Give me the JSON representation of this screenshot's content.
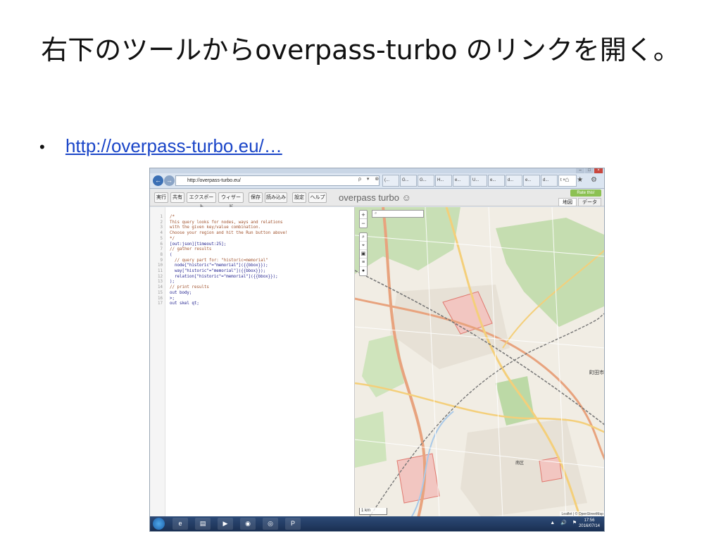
{
  "slide": {
    "title": "右下のツールからoverpass-turbo のリンクを開く。",
    "bullet_link": "http://overpass-turbo.eu/…"
  },
  "browser": {
    "url": "http://overpass-turbo.eu/",
    "url_icons": "ρ ▾ ⊗ C",
    "tabs": [
      {
        "label": "(... ",
        "active": false
      },
      {
        "label": "G...",
        "active": false
      },
      {
        "label": "G...",
        "active": false
      },
      {
        "label": "H...",
        "active": false
      },
      {
        "label": "e...",
        "active": false
      },
      {
        "label": "U...",
        "active": false
      },
      {
        "label": "e...",
        "active": false
      },
      {
        "label": "d...",
        "active": false
      },
      {
        "label": "e...",
        "active": false
      },
      {
        "label": "d...",
        "active": false
      },
      {
        "label": "t ×",
        "active": true
      }
    ],
    "icons": [
      "home-icon",
      "star-icon",
      "gear-icon"
    ],
    "icon_glyphs": "⌂ ★ ⚙"
  },
  "toolbar": {
    "buttons": [
      "実行",
      "共有",
      "エクスポート",
      "ウィザード",
      "保存",
      "読み込み",
      "設定",
      "ヘルプ"
    ],
    "app_title": "overpass turbo ☺",
    "rate_label": "Rate this!",
    "view_tabs": [
      "地図",
      "データ"
    ]
  },
  "editor": {
    "lines": [
      {
        "n": "1",
        "text": "/*",
        "kind": "comment"
      },
      {
        "n": "2",
        "text": "This query looks for nodes, ways and relations",
        "kind": "comment"
      },
      {
        "n": "3",
        "text": "with the given key/value combination.",
        "kind": "comment"
      },
      {
        "n": "4",
        "text": "Choose your region and hit the Run button above!",
        "kind": "comment"
      },
      {
        "n": "5",
        "text": "*/",
        "kind": "comment"
      },
      {
        "n": "6",
        "text": "[out:json][timeout:25];",
        "kind": "code"
      },
      {
        "n": "7",
        "text": "// gather results",
        "kind": "comment"
      },
      {
        "n": "8",
        "text": "(",
        "kind": "code"
      },
      {
        "n": "9",
        "text": "  // query part for: \"historic=memorial\"",
        "kind": "comment"
      },
      {
        "n": "10",
        "text": "  node[\"historic\"=\"memorial\"]({{bbox}});",
        "kind": "code"
      },
      {
        "n": "11",
        "text": "  way[\"historic\"=\"memorial\"]({{bbox}});",
        "kind": "code"
      },
      {
        "n": "12",
        "text": "  relation[\"historic\"=\"memorial\"]({{bbox}});",
        "kind": "code"
      },
      {
        "n": "13",
        "text": ");",
        "kind": "code"
      },
      {
        "n": "14",
        "text": "// print results",
        "kind": "comment"
      },
      {
        "n": "15",
        "text": "out body;",
        "kind": "code"
      },
      {
        "n": "16",
        "text": ">;",
        "kind": "code"
      },
      {
        "n": "17",
        "text": "out skel qt;",
        "kind": "code"
      }
    ]
  },
  "map": {
    "zoom_in": "+",
    "zoom_out": "−",
    "tools": [
      "⌕",
      "⌖",
      "▣",
      "≡",
      "●"
    ],
    "scale_label": "1 km",
    "attribution": "Leaflet | © OpenStreetMap",
    "labels": [
      {
        "text": "町田市",
        "kind": "city"
      },
      {
        "text": "南区",
        "kind": "ward"
      }
    ]
  },
  "taskbar": {
    "icons": [
      {
        "name": "ie-icon",
        "glyph": "e"
      },
      {
        "name": "folder-icon",
        "glyph": "▤"
      },
      {
        "name": "media-player-icon",
        "glyph": "▶"
      },
      {
        "name": "firefox-icon",
        "glyph": "◉"
      },
      {
        "name": "chrome-icon",
        "glyph": "◎"
      },
      {
        "name": "powerpoint-icon",
        "glyph": "P"
      }
    ],
    "tray": "▲ 🔊 ⚑",
    "time": "17:56",
    "date": "2016/07/14"
  }
}
